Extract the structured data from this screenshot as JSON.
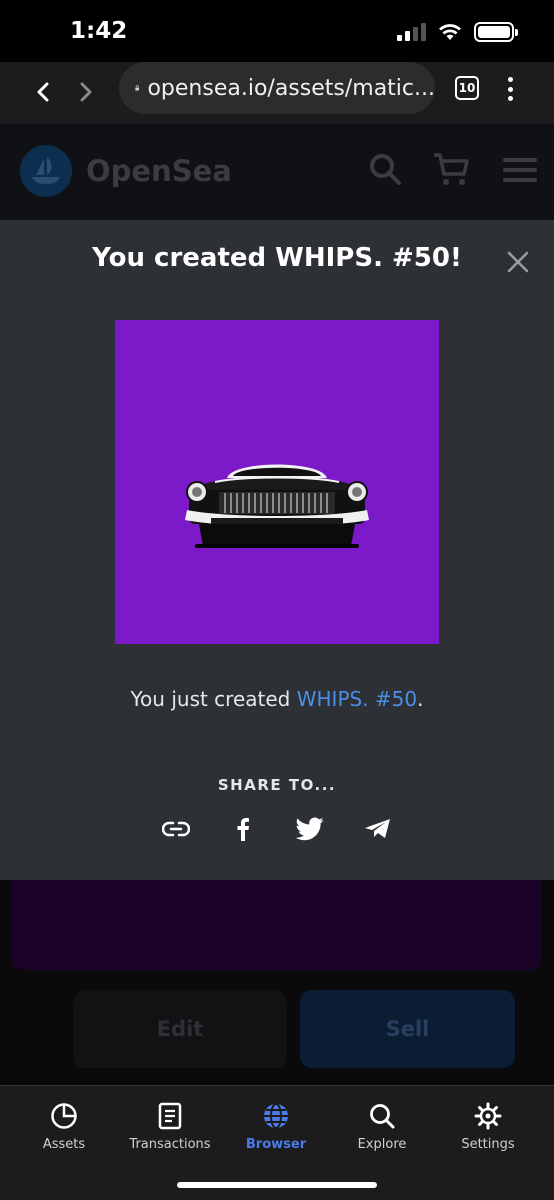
{
  "status_bar": {
    "time": "1:42",
    "icons": [
      "cellular-signal-icon",
      "wifi-icon",
      "battery-icon"
    ]
  },
  "browser": {
    "url": "opensea.io/assets/matic...",
    "tab_count": "10",
    "icons": [
      "back-icon",
      "forward-icon",
      "lock-icon",
      "tabs-icon",
      "more-icon"
    ]
  },
  "site_header": {
    "brand": "OpenSea",
    "icons": [
      "search-icon",
      "cart-icon",
      "menu-icon"
    ]
  },
  "modal": {
    "title": "You created WHIPS. #50!",
    "created_prefix": "You just created ",
    "created_link": "WHIPS. #50",
    "created_suffix": ".",
    "share_label": "SHARE TO...",
    "share_icons": [
      "link-icon",
      "facebook-icon",
      "twitter-icon",
      "telegram-icon"
    ],
    "image_bg": "#7c19c8"
  },
  "actions": {
    "edit_label": "Edit",
    "sell_label": "Sell"
  },
  "bottom_nav": {
    "items": [
      {
        "label": "Assets",
        "icon": "pie-chart-icon"
      },
      {
        "label": "Transactions",
        "icon": "document-icon"
      },
      {
        "label": "Browser",
        "icon": "globe-icon"
      },
      {
        "label": "Explore",
        "icon": "search-icon"
      },
      {
        "label": "Settings",
        "icon": "gear-icon"
      }
    ],
    "active": "Browser",
    "active_color": "#4b7be6"
  }
}
